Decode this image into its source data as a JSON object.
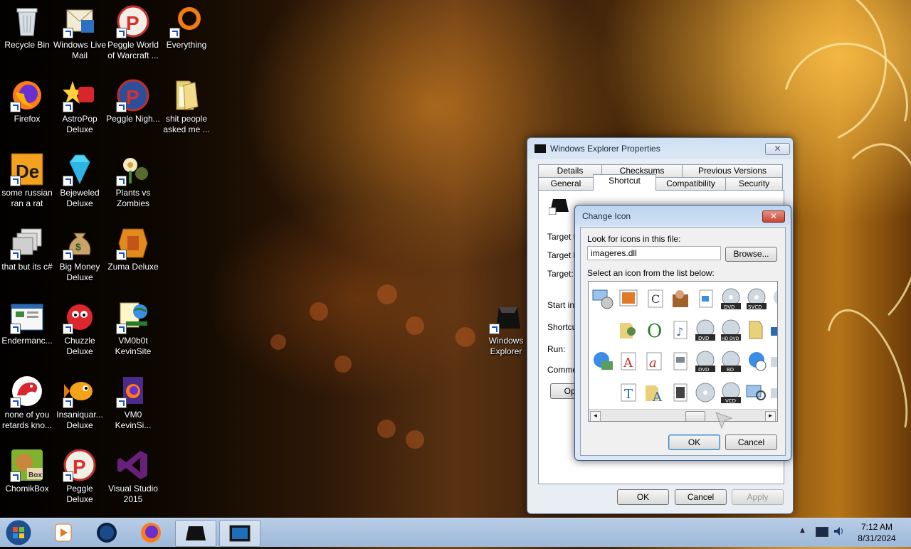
{
  "desktop": {
    "icons": [
      {
        "label": "Recycle Bin",
        "icon": "recycle-bin-icon"
      },
      {
        "label": "Windows Live Mail",
        "icon": "mail-icon"
      },
      {
        "label": "Peggle World of Warcraft ...",
        "icon": "peggle-icon"
      },
      {
        "label": "Everything",
        "icon": "everything-icon"
      },
      {
        "label": "Firefox",
        "icon": "firefox-icon"
      },
      {
        "label": "AstroPop Deluxe",
        "icon": "astropop-icon"
      },
      {
        "label": "Peggle Nigh...",
        "icon": "peggle-icon"
      },
      {
        "label": "shit people asked me ...",
        "icon": "folder-icon"
      },
      {
        "label": "some russian ran a rat",
        "icon": "de-icon"
      },
      {
        "label": "Bejeweled Deluxe",
        "icon": "gem-icon"
      },
      {
        "label": "Plants vs Zombies",
        "icon": "plants-icon"
      },
      {
        "label": "that but its c#",
        "icon": "windows-stack-icon"
      },
      {
        "label": "Big Money Deluxe",
        "icon": "money-bag-icon"
      },
      {
        "label": "Zuma Deluxe",
        "icon": "zuma-icon"
      },
      {
        "label": "Endermanc...",
        "icon": "program-window-icon"
      },
      {
        "label": "Chuzzle Deluxe",
        "icon": "chuzzle-icon"
      },
      {
        "label": "VM0b0t KevinSite",
        "icon": "web-shortcut-icon"
      },
      {
        "label": "none of you retards kno...",
        "icon": "lizard-icon"
      },
      {
        "label": "Insaniquar... Deluxe",
        "icon": "fish-icon"
      },
      {
        "label": "VM0 KevinSi...",
        "icon": "firefox-doc-icon"
      },
      {
        "label": "ChomikBox",
        "icon": "chomikbox-icon"
      },
      {
        "label": "Peggle Deluxe",
        "icon": "peggle-icon"
      },
      {
        "label": "Visual Studio 2015",
        "icon": "visual-studio-icon"
      },
      {
        "label": "Windows Explorer",
        "icon": "explorer-icon"
      }
    ]
  },
  "properties": {
    "title": "Windows Explorer Properties",
    "tabs_row1": [
      "Details",
      "Checksums",
      "Previous Versions"
    ],
    "tabs_row2": [
      "General",
      "Shortcut",
      "Compatibility",
      "Security"
    ],
    "fields": [
      "Target ty",
      "Target lo",
      "Target:",
      "Start in:",
      "Shortcut",
      "Run:",
      "Commen"
    ],
    "open_button": "Ope",
    "ok": "OK",
    "cancel": "Cancel",
    "apply": "Apply"
  },
  "change_icon": {
    "title": "Change Icon",
    "look_label": "Look for icons in this file:",
    "file_value": "imageres.dll",
    "browse": "Browse...",
    "select_label": "Select an icon from the list below:",
    "ok": "OK",
    "cancel": "Cancel",
    "icon_captions": [
      "DVD",
      "SVCD",
      "DVD",
      "HD DVD",
      "DVD",
      "BD",
      "VCD"
    ]
  },
  "taskbar": {
    "time": "7:12 AM",
    "date": "8/31/2024",
    "items": [
      "start-orb",
      "media-player",
      "globe",
      "firefox",
      "windows-explorer",
      "window-app"
    ]
  },
  "colors": {
    "titlebar": "#cfe0f3",
    "taskbar": "#a7c0e0",
    "close_red": "#c84536",
    "highlight": "#3a8ee6"
  }
}
